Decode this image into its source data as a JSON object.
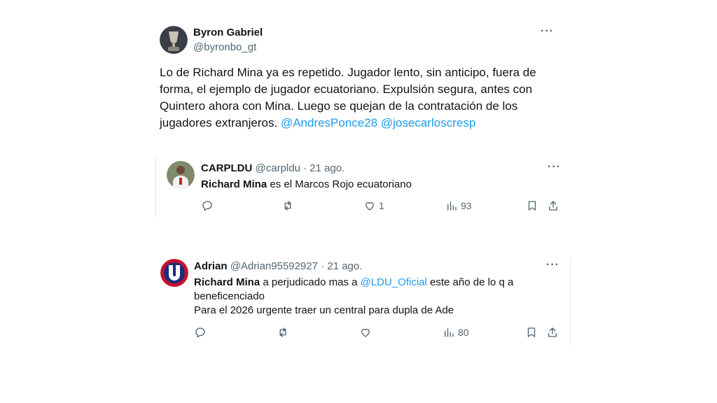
{
  "main_tweet": {
    "name": "Byron Gabriel",
    "handle": "@byronbo_gt",
    "text_lines": [
      "Lo de Richard Mina ya es repetido. Jugador lento, sin anticipo, fuera de",
      "forma, el ejemplo de jugador ecuatoriano. Expulsión segura, antes con",
      "Quintero ahora con Mina. Luego se quejan de la contratación de los",
      "jugadores extranjeros. "
    ],
    "mention1": "@AndresPonce28",
    "mention2": "@josecarloscresp",
    "more_icon": "more-horizontal-icon"
  },
  "reply1": {
    "name": "CARPLDU",
    "handle": "@carpldu",
    "separator": "·",
    "date": "21 ago.",
    "bold": "Richard Mina",
    "text": " es el Marcos Rojo ecuatoriano",
    "likes": "1",
    "views": "93"
  },
  "reply2": {
    "name": "Adrian",
    "handle": "@Adrian95592927",
    "separator": "·",
    "date": "21 ago.",
    "bold": "Richard Mina",
    "text_a": " a perjudicado mas a ",
    "mention": "@LDU_Oficial",
    "text_b": " este año de lo q a",
    "line2": "beneficenciado",
    "line3": "Para el 2026 urgente traer un central para dupla de Ade",
    "views": "80"
  },
  "colors": {
    "link": "#1d9bf0",
    "muted": "#536471",
    "text": "#0f1419"
  }
}
